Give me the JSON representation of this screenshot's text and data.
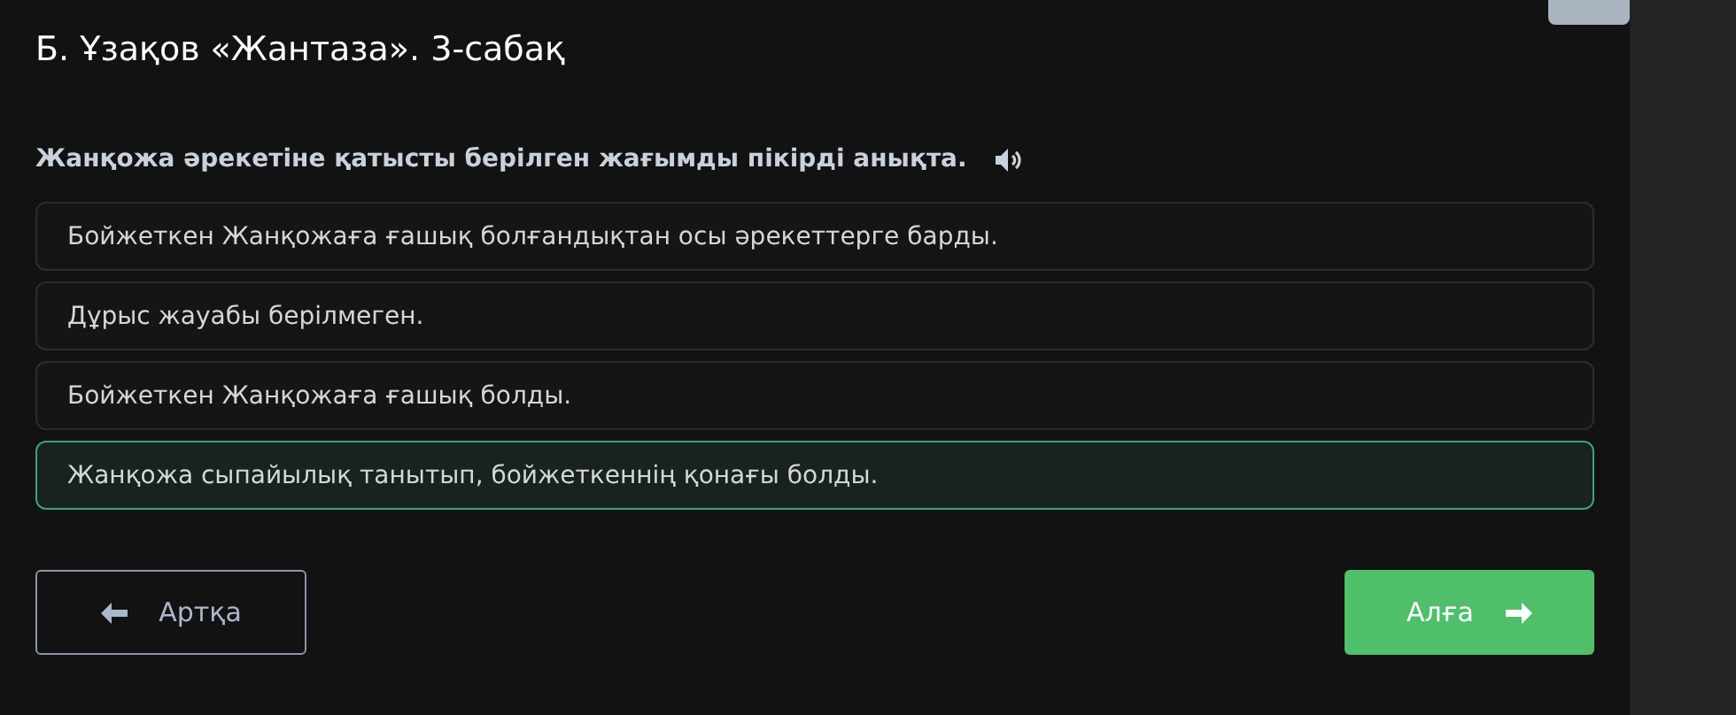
{
  "title": "Б. Ұзақов «Жантаза». 3-сабақ",
  "question": "Жанқожа әрекетіне қатысты берілген жағымды пікірді анықта.",
  "options": [
    {
      "label": "Бойжеткен Жанқожаға ғашық болғандықтан осы әрекеттерге барды.",
      "selected": false
    },
    {
      "label": "Дұрыс жауабы берілмеген.",
      "selected": false
    },
    {
      "label": "Бойжеткен Жанқожаға ғашық болды.",
      "selected": false
    },
    {
      "label": "Жанқожа сыпайылық танытып, бойжеткеннің қонағы болды.",
      "selected": true
    }
  ],
  "buttons": {
    "back": "Артқа",
    "next": "Алға"
  }
}
